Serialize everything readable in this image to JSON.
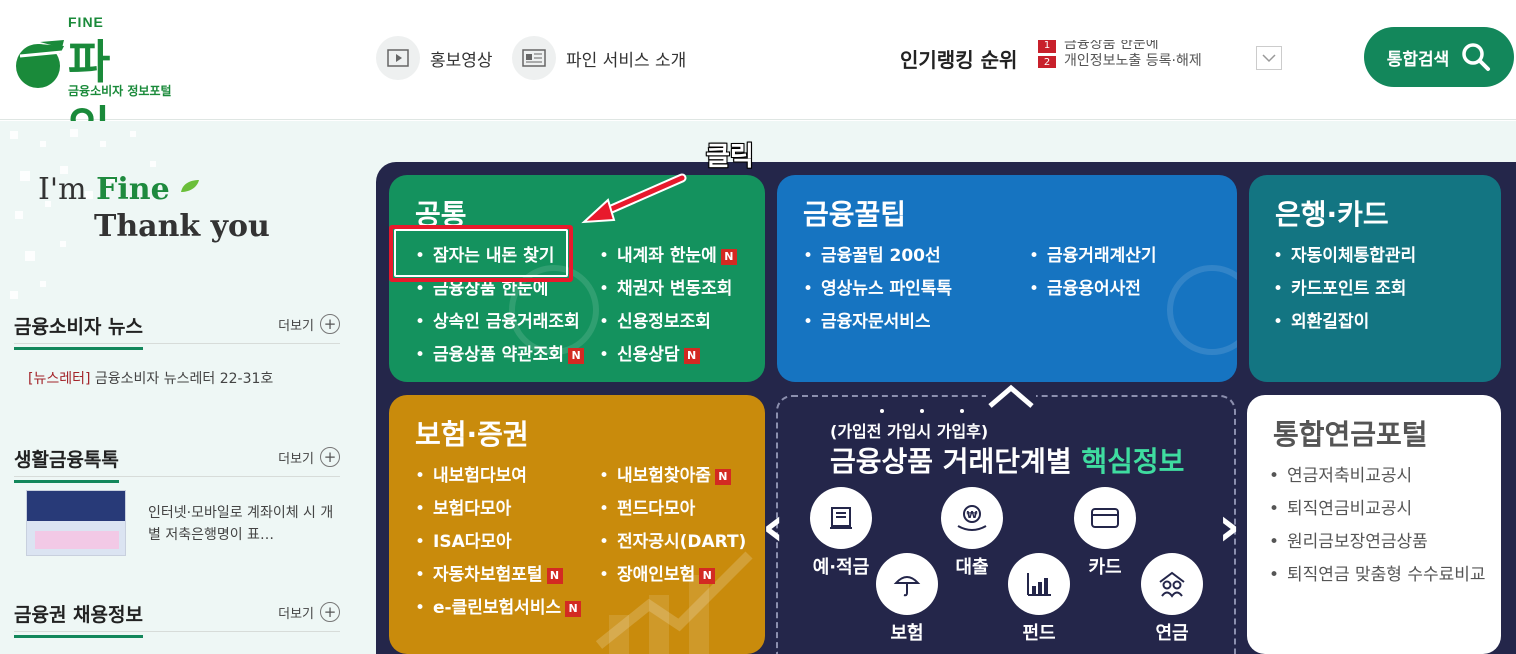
{
  "header": {
    "logo": {
      "top_text": "FINE",
      "main_text": "파 인",
      "sub_text": "금융소비자 정보포털"
    },
    "promo_video_label": "홍보영상",
    "service_intro_label": "파인 서비스 소개",
    "ranking_title": "인기랭킹 순위",
    "ranking_items": [
      {
        "num": "1",
        "text": "금융상품 한눈에"
      },
      {
        "num": "2",
        "text": "개인정보노출 등록·해제"
      }
    ],
    "search_label": "통합검색"
  },
  "left": {
    "tagline_1a": "I'm ",
    "tagline_1b": "Fine",
    "tagline_2": "Thank you",
    "more_label": "더보기",
    "news": {
      "title": "금융소비자 뉴스",
      "item_tag": "[뉴스레터]",
      "item_text": "금융소비자 뉴스레터 22-31호"
    },
    "talk": {
      "title": "생활금융톡톡",
      "item_text": "인터넷·모바일로 계좌이체 시 개별 저축은행명이 표…"
    },
    "jobs": {
      "title": "금융권 채용정보"
    }
  },
  "cards": {
    "common": {
      "title": "공통",
      "items": [
        "잠자는 내돈 찾기",
        "금융상품 한눈에",
        "상속인 금융거래조회",
        "금융상품 약관조회",
        "내계좌 한눈에",
        "채권자 변동조회",
        "신용정보조회",
        "신용상담"
      ]
    },
    "tips": {
      "title": "금융꿀팁",
      "items": [
        "금융꿀팁 200선",
        "영상뉴스 파인톡톡",
        "금융자문서비스",
        "금융거래계산기",
        "금융용어사전"
      ]
    },
    "bank": {
      "title": "은행·카드",
      "items": [
        "자동이체통합관리",
        "카드포인트 조회",
        "외환길잡이"
      ]
    },
    "insurance": {
      "title": "보험·증권",
      "items": [
        "내보험다보여",
        "보험다모아",
        "ISA다모아",
        "자동차보험포털",
        "e-클린보험서비스",
        "내보험찾아줌",
        "펀드다모아",
        "전자공시(DART)",
        "장애인보험"
      ]
    },
    "pension": {
      "title": "통합연금포털",
      "items": [
        "연금저축비교공시",
        "퇴직연금비교공시",
        "원리금보장연금상품",
        "퇴직연금 맞춤형 수수료비교"
      ]
    }
  },
  "stage": {
    "subtitle": "(가입전 가입시 가입후)",
    "title_a": "금융상품 거래단계별 ",
    "title_b": "핵심정보",
    "products": [
      "예·적금",
      "대출",
      "카드",
      "보험",
      "펀드",
      "연금"
    ]
  },
  "annotation": {
    "click_label": "클릭"
  },
  "badge": "N",
  "colors": {
    "brand_green": "#13875b",
    "common_card": "#14925e",
    "tips_card": "#1674c1",
    "bank_card": "#137582",
    "insurance_card": "#c98b0c",
    "panel_bg": "#24264a",
    "highlight": "#e8192c",
    "new_badge": "#d32a22"
  }
}
